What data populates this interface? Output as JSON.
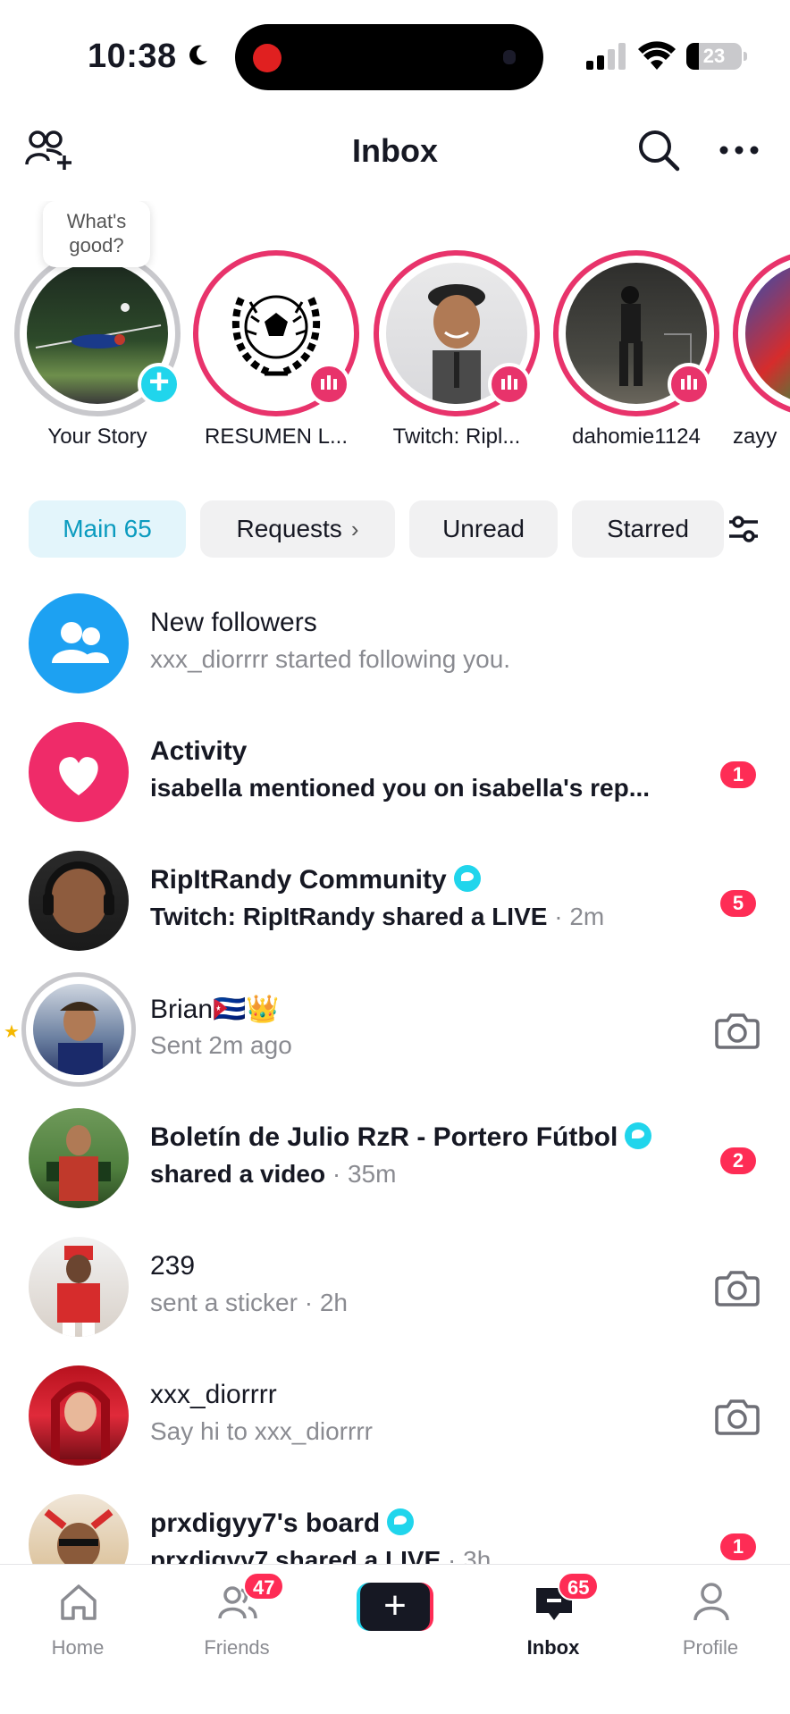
{
  "status_bar": {
    "time": "10:38",
    "battery": "23",
    "battery_level": 0.23
  },
  "header": {
    "title": "Inbox"
  },
  "stories": {
    "bubble_text": "What's good?",
    "items": [
      {
        "name": "Your Story",
        "type": "self"
      },
      {
        "name": "RESUMEN L...",
        "type": "live"
      },
      {
        "name": "Twitch: Ripl...",
        "type": "live"
      },
      {
        "name": "dahomie1124",
        "type": "live"
      },
      {
        "name": "zayy",
        "type": "live"
      }
    ]
  },
  "tabs": {
    "main": "Main 65",
    "requests": "Requests",
    "unread": "Unread",
    "starred": "Starred"
  },
  "inbox": [
    {
      "title": "New followers",
      "subtitle": "xxx_diorrrr started following you.",
      "time": "",
      "badge": "",
      "title_bold": false,
      "sub_bold": false
    },
    {
      "title": "Activity",
      "subtitle": "isabella mentioned you on isabella's rep...",
      "time": "",
      "badge": "1",
      "title_bold": true,
      "sub_bold": true
    },
    {
      "title": "RipItRandy Community",
      "subtitle": "Twitch: RipItRandy shared a LIVE",
      "time": " · 2m",
      "badge": "5",
      "title_bold": true,
      "sub_bold": true
    },
    {
      "title": "Brian🇨🇺👑",
      "subtitle": "Sent 2m ago",
      "time": "",
      "badge": "",
      "title_bold": false,
      "sub_bold": false
    },
    {
      "title": "Boletín de Julio RzR - Portero Fútbol",
      "subtitle": "shared a video",
      "time": " · 35m",
      "badge": "2",
      "title_bold": true,
      "sub_bold": true
    },
    {
      "title": "239",
      "subtitle": "sent a sticker",
      "time": " · 2h",
      "badge": "",
      "title_bold": false,
      "sub_bold": false
    },
    {
      "title": "xxx_diorrrr",
      "subtitle": "Say hi to xxx_diorrrr",
      "time": "",
      "badge": "",
      "title_bold": false,
      "sub_bold": false
    },
    {
      "title": "prxdigyy7's board",
      "subtitle": "prxdigyy7 shared a LIVE",
      "time": " · 3h",
      "badge": "1",
      "title_bold": true,
      "sub_bold": true
    }
  ],
  "bottom_nav": {
    "home": "Home",
    "friends": "Friends",
    "friends_badge": "47",
    "inbox": "Inbox",
    "inbox_badge": "65",
    "profile": "Profile"
  },
  "colors": {
    "accent": "#20d5ec",
    "brand_red": "#fe2c55",
    "live_ring": "#e8336b",
    "followers_blue": "#1da1f2",
    "activity_pink": "#ef2b69"
  }
}
